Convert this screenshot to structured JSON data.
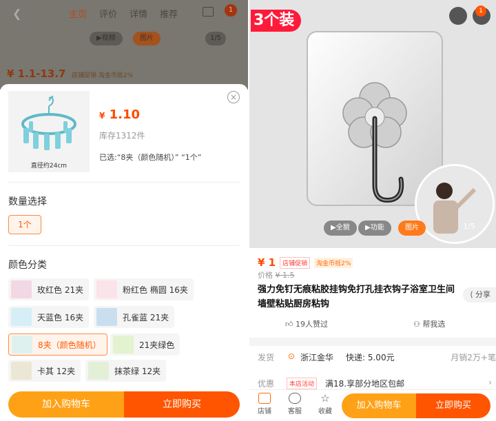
{
  "left": {
    "header": {
      "tabs": [
        "主页",
        "评价",
        "详情",
        "推荐"
      ],
      "badge": "1",
      "video_label": "▶视频",
      "pic_label": "图片",
      "counter": "1/5",
      "price_range": "¥ 1.1-13.7",
      "tags": "店铺促销  淘金币抵2%"
    },
    "sku": {
      "image_caption": "直径约24cm",
      "currency": "¥",
      "price": "1.10",
      "stock": "库存1312件",
      "selected": "已选:“8夹（颜色随机）” “1个”"
    },
    "quantity": {
      "title": "数量选择",
      "options": [
        "1个"
      ]
    },
    "color": {
      "title": "颜色分类",
      "options": [
        {
          "label": "玫红色 21夹",
          "selected": false
        },
        {
          "label": "粉红色 椭圆 16夹",
          "selected": false
        },
        {
          "label": "天蓝色 16夹",
          "selected": false
        },
        {
          "label": "孔雀蓝 21夹",
          "selected": false
        },
        {
          "label": "8夹（颜色随机）",
          "selected": true
        },
        {
          "label": "21夹绿色",
          "selected": false
        },
        {
          "label": "卡其 12夹",
          "selected": false
        },
        {
          "label": "抹茶绿 12夹",
          "selected": false
        }
      ]
    },
    "buttons": {
      "add_to_cart": "加入购物车",
      "buy_now": "立即购买"
    }
  },
  "right": {
    "hero": {
      "pack_label": "3个装",
      "badge": "1",
      "panorama": "▶全貌",
      "feature": "▶功能",
      "picture": "图片",
      "counter": "1/5"
    },
    "price": {
      "current": "¥ 1",
      "tag_promo": "店铺促销",
      "tag_coin": "淘金币抵2%",
      "orig_label": "价格",
      "orig_value": "¥ 1.5"
    },
    "title": "强力免钉无痕粘胶挂钩免打孔挂衣钩子浴室卫生间墙壁粘贴厨房粘钩",
    "share": "分享",
    "likes": "19人赞过",
    "help_choose": "帮我选",
    "shipping": {
      "label": "发货",
      "location": "浙江金华",
      "express": "快递: 5.00元",
      "monthly": "月销2万+笔"
    },
    "discount": {
      "label": "优惠",
      "tag": "本店活动",
      "text": "满18.享部分地区包邮"
    },
    "bottom_nav": [
      "店铺",
      "客服",
      "收藏"
    ],
    "buttons": {
      "add_to_cart": "加入购物车",
      "buy_now": "立即购买"
    }
  },
  "colors": {
    "accent": "#ff5500",
    "accent_light": "#ffa116",
    "price": "#ff4a00"
  }
}
